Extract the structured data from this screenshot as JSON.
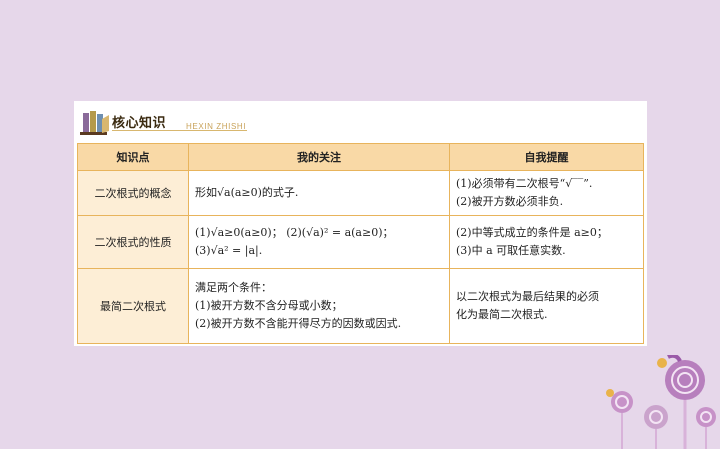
{
  "header": {
    "title": "核心知识",
    "subtitle": "HEXIN ZHISHI"
  },
  "table": {
    "columns": [
      "知识点",
      "我的关注",
      "自我提醒"
    ],
    "rows": [
      {
        "topic": "二次根式的概念",
        "focus": [
          "形如√a(a≥0)的式子."
        ],
        "reminder": [
          "(1)必须带有二次根号“√‾‾”.",
          "(2)被开方数必须非负."
        ]
      },
      {
        "topic": "二次根式的性质",
        "focus": [
          "(1)√a≥0(a≥0)；  (2)(√a)² = a(a≥0)；",
          "(3)√a² = |a|."
        ],
        "reminder": [
          "(2)中等式成立的条件是 a≥0；",
          "(3)中 a 可取任意实数."
        ]
      },
      {
        "topic": "最简二次根式",
        "focus": [
          "满足两个条件：",
          "(1)被开方数不含分母或小数；",
          "(2)被开方数不含能开得尽方的因数或因式."
        ],
        "reminder": [
          "以二次根式为最后结果的必须",
          "化为最简二次根式."
        ]
      }
    ]
  },
  "colors": {
    "background": "#e6d7ea",
    "header_fill": "#f9d9a6",
    "topic_fill": "#fdeed6",
    "border": "#e8b45c"
  }
}
